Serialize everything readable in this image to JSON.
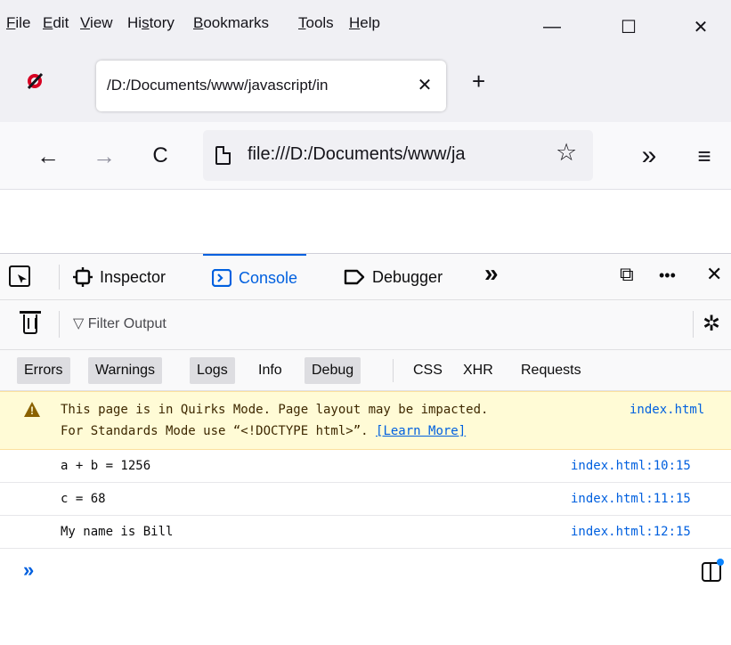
{
  "menubar": {
    "items": [
      {
        "label": "File",
        "u": "F",
        "rest": "ile"
      },
      {
        "label": "Edit",
        "u": "E",
        "rest": "dit"
      },
      {
        "label": "View",
        "u": "V",
        "rest": "iew"
      },
      {
        "label": "History",
        "pre": "Hi",
        "u": "s",
        "rest": "tory"
      },
      {
        "label": "Bookmarks",
        "u": "B",
        "rest": "ookmarks"
      },
      {
        "label": "Tools",
        "u": "T",
        "rest": "ools"
      },
      {
        "label": "Help",
        "u": "H",
        "rest": "elp"
      }
    ],
    "window_controls": {
      "minimize": "—",
      "maximize": "☐",
      "close": "✕"
    }
  },
  "tab": {
    "title": "/D:/Documents/www/javascript/in",
    "close": "✕",
    "new_tab": "+"
  },
  "navbar": {
    "back": "←",
    "forward": "→",
    "reload": "C",
    "url": "file:///D:/Documents/www/ja",
    "star": "☆",
    "overflow": "»",
    "menu": "≡"
  },
  "devtools": {
    "tabs": [
      {
        "label": "Inspector",
        "icon": "inspector-icon"
      },
      {
        "label": "Console",
        "icon": "console-icon",
        "selected": true
      },
      {
        "label": "Debugger",
        "icon": "debugger-icon"
      }
    ],
    "more_tools": "»",
    "dock": "⧉",
    "meatball": "•••",
    "close": "✕",
    "filter_placeholder": "Filter Output",
    "filter_icon": "▽",
    "settings_icon": "✲",
    "levels": [
      {
        "label": "Errors",
        "on": true
      },
      {
        "label": "Warnings",
        "on": true
      },
      {
        "label": "Logs",
        "on": true
      },
      {
        "label": "Info",
        "on": false
      },
      {
        "label": "Debug",
        "on": true
      }
    ],
    "net_filters": [
      "CSS",
      "XHR",
      "Requests"
    ],
    "warning": {
      "line1": "This page is in Quirks Mode. Page layout may be impacted.",
      "line2_pre": "For Standards Mode use “<!DOCTYPE html>”. ",
      "link": "[Learn More]",
      "source": "index.html"
    },
    "messages": [
      {
        "text": "a + b = 1256",
        "source": "index.html:10:15"
      },
      {
        "text": "c = 68",
        "source": "index.html:11:15"
      },
      {
        "text": "My name is Bill",
        "source": "index.html:12:15"
      }
    ],
    "prompt": "»",
    "colors": {
      "accent": "#0060df",
      "warning_bg": "#fffbd6"
    }
  }
}
